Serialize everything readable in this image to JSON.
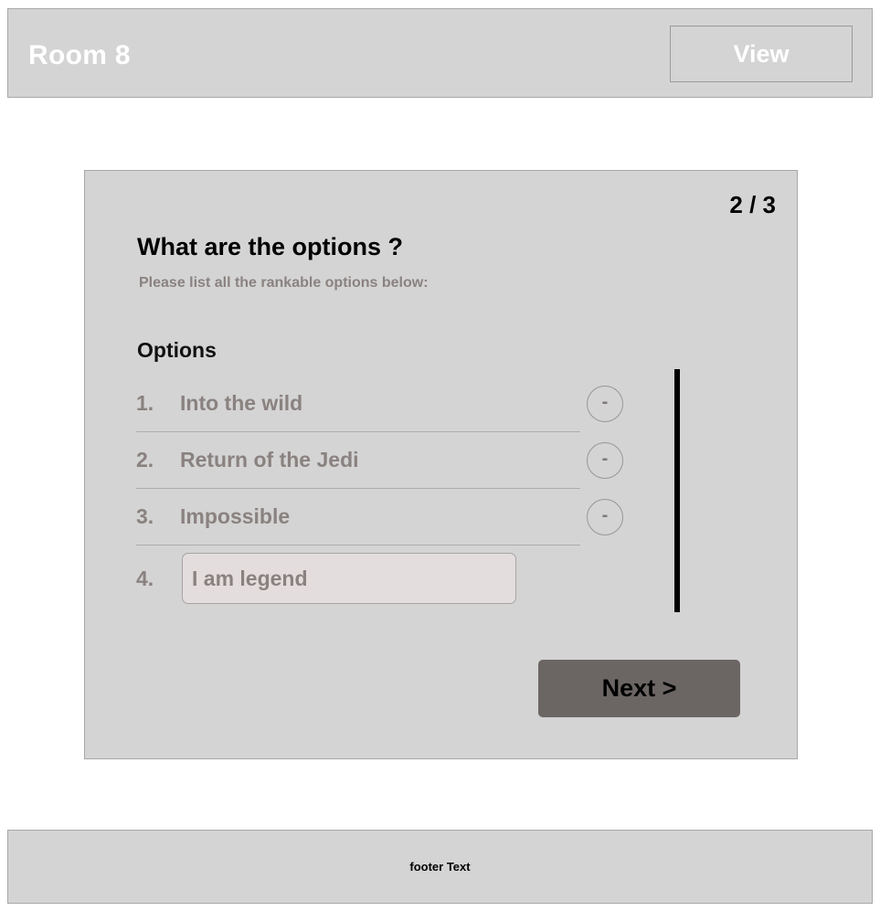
{
  "header": {
    "title": "Room 8",
    "view_button_label": "View"
  },
  "card": {
    "page_counter": "2 / 3",
    "heading": "What are the options ?",
    "subheading": "Please list all the rankable options below:",
    "options_title": "Options",
    "remove_glyph": "-",
    "options": [
      {
        "index": "1.",
        "label": "Into the wild",
        "type": "static"
      },
      {
        "index": "2.",
        "label": "Return of the Jedi",
        "type": "static"
      },
      {
        "index": "3.",
        "label": "Impossible",
        "type": "static"
      },
      {
        "index": "4.",
        "value": "I am legend",
        "placeholder": "",
        "type": "input"
      }
    ],
    "next_button_label": "Next >"
  },
  "footer": {
    "text": "footer Text"
  },
  "colors": {
    "panel": "#d4d4d4",
    "panel_border": "#a8a8a8",
    "page_background": "#ffffff",
    "muted_text": "#8a8280",
    "input_fill": "#e3dedd",
    "next_button_fill": "#6b6664",
    "scrollbar": "#000000"
  }
}
